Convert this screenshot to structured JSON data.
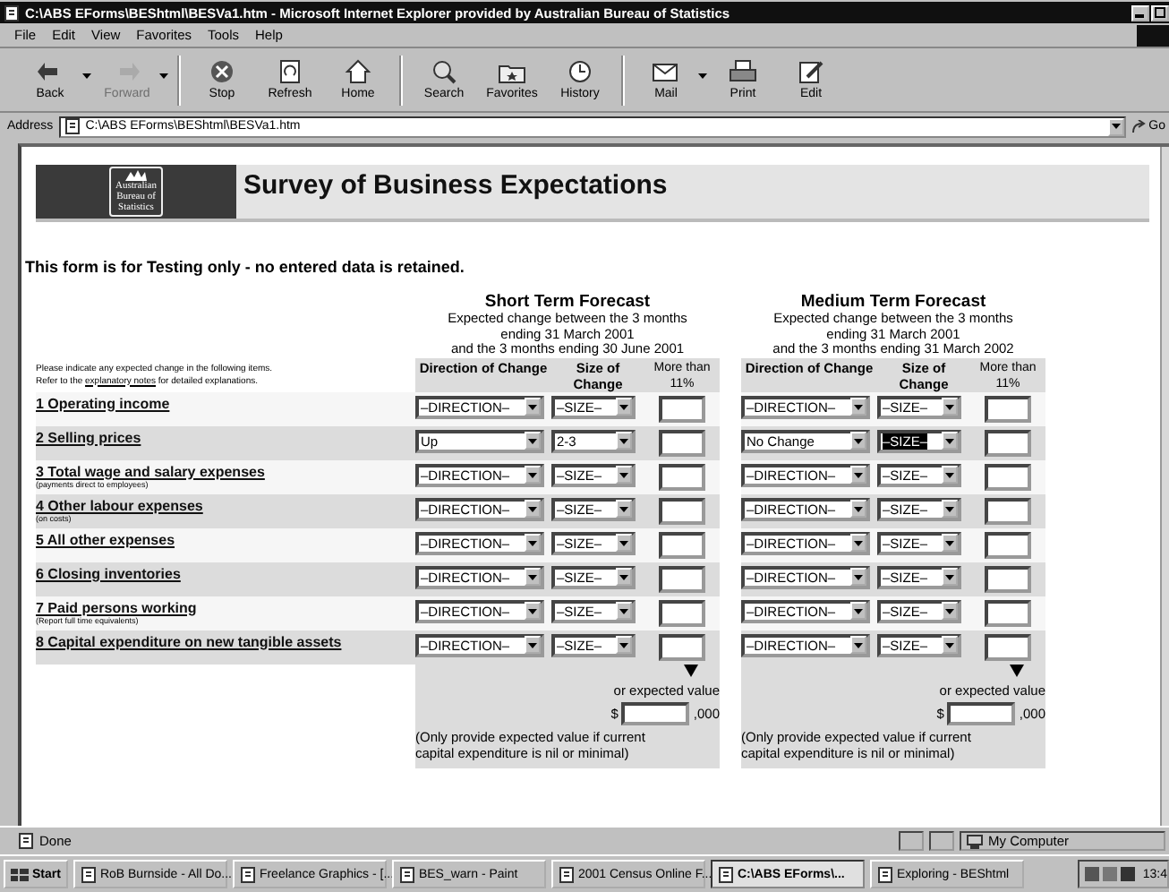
{
  "window": {
    "title": "C:\\ABS EForms\\BEShtml\\BESVa1.htm - Microsoft Internet Explorer provided by Australian Bureau of Statistics"
  },
  "menu": [
    "File",
    "Edit",
    "View",
    "Favorites",
    "Tools",
    "Help"
  ],
  "toolbar": [
    {
      "label": "Back",
      "kind": "back",
      "disabled": false,
      "caret": true
    },
    {
      "label": "Forward",
      "kind": "forward",
      "disabled": true,
      "caret": true
    },
    {
      "label": "Stop",
      "kind": "stop",
      "disabled": false,
      "caret": false
    },
    {
      "label": "Refresh",
      "kind": "refresh",
      "disabled": false,
      "caret": false
    },
    {
      "label": "Home",
      "kind": "home",
      "disabled": false,
      "caret": false
    },
    {
      "label": "Search",
      "kind": "search",
      "disabled": false,
      "caret": false
    },
    {
      "label": "Favorites",
      "kind": "favorites",
      "disabled": false,
      "caret": false
    },
    {
      "label": "History",
      "kind": "history",
      "disabled": false,
      "caret": false
    },
    {
      "label": "Mail",
      "kind": "mail",
      "disabled": false,
      "caret": true
    },
    {
      "label": "Print",
      "kind": "print",
      "disabled": false,
      "caret": false
    },
    {
      "label": "Edit",
      "kind": "edit",
      "disabled": false,
      "caret": false
    }
  ],
  "address": {
    "label": "Address",
    "value": "C:\\ABS EForms\\BEShtml\\BESVa1.htm",
    "go": "Go"
  },
  "page": {
    "logo": [
      "Australian",
      "Bureau of",
      "Statistics"
    ],
    "title": "Survey of Business Expectations",
    "notice": "This form is for Testing only - no entered data is retained.",
    "intro": {
      "line": "Please indicate any expected change in the following items.",
      "before": "Refer to the ",
      "link": "explanatory notes",
      "after": " for detailed explanations."
    },
    "forecasts": [
      {
        "title": "Short Term Forecast",
        "description": [
          "Expected change between the 3 months",
          "ending 31 March 2001",
          "and the 3 months ending 30 June 2001"
        ],
        "columns": [
          "Direction of Change",
          "Size of Change",
          "More than 11%"
        ],
        "expected": {
          "label": "or expected value",
          "currency": "$",
          "suffix": ",000",
          "note": "(Only provide expected value if current capital expenditure is nil or minimal)"
        }
      },
      {
        "title": "Medium Term Forecast",
        "description": [
          "Expected change between the 3 months",
          "ending 31 March 2001",
          "and the 3 months ending 31 March 2002"
        ],
        "columns": [
          "Direction of Change",
          "Size of Change",
          "More than 11%"
        ],
        "expected": {
          "label": "or expected value",
          "currency": "$",
          "suffix": ",000",
          "note": "(Only provide expected value if current capital expenditure is nil or minimal)"
        }
      }
    ],
    "rows": [
      {
        "label": "1 Operating income",
        "short": [
          {
            "value": "–DIRECTION–",
            "focused": false
          },
          {
            "value": "–SIZE–",
            "focused": false
          }
        ],
        "medium": [
          {
            "value": "–DIRECTION–",
            "focused": false
          },
          {
            "value": "–SIZE–",
            "focused": false
          }
        ]
      },
      {
        "label": "2 Selling prices",
        "short": [
          {
            "value": "Up",
            "focused": false
          },
          {
            "value": "2-3",
            "focused": false
          }
        ],
        "medium": [
          {
            "value": "No Change",
            "focused": false
          },
          {
            "value": "–SIZE–",
            "focused": true
          }
        ]
      },
      {
        "label": "3 Total wage and salary expenses",
        "note": "(payments direct to employees)",
        "short": [
          {
            "value": "–DIRECTION–",
            "focused": false
          },
          {
            "value": "–SIZE–",
            "focused": false
          }
        ],
        "medium": [
          {
            "value": "–DIRECTION–",
            "focused": false
          },
          {
            "value": "–SIZE–",
            "focused": false
          }
        ]
      },
      {
        "label": "4 Other labour expenses",
        "note": "(on costs)",
        "short": [
          {
            "value": "–DIRECTION–",
            "focused": false
          },
          {
            "value": "–SIZE–",
            "focused": false
          }
        ],
        "medium": [
          {
            "value": "–DIRECTION–",
            "focused": false
          },
          {
            "value": "–SIZE–",
            "focused": false
          }
        ]
      },
      {
        "label": "5 All other expenses",
        "short": [
          {
            "value": "–DIRECTION–",
            "focused": false
          },
          {
            "value": "–SIZE–",
            "focused": false
          }
        ],
        "medium": [
          {
            "value": "–DIRECTION–",
            "focused": false
          },
          {
            "value": "–SIZE–",
            "focused": false
          }
        ]
      },
      {
        "label": "6 Closing inventories",
        "short": [
          {
            "value": "–DIRECTION–",
            "focused": false
          },
          {
            "value": "–SIZE–",
            "focused": false
          }
        ],
        "medium": [
          {
            "value": "–DIRECTION–",
            "focused": false
          },
          {
            "value": "–SIZE–",
            "focused": false
          }
        ]
      },
      {
        "label": "7 Paid persons working",
        "note": "(Report full time equivalents)",
        "short": [
          {
            "value": "–DIRECTION–",
            "focused": false
          },
          {
            "value": "–SIZE–",
            "focused": false
          }
        ],
        "medium": [
          {
            "value": "–DIRECTION–",
            "focused": false
          },
          {
            "value": "–SIZE–",
            "focused": false
          }
        ]
      },
      {
        "label": "8 Capital expenditure on new tangible assets",
        "short": [
          {
            "value": "–DIRECTION–",
            "focused": false
          },
          {
            "value": "–SIZE–",
            "focused": false
          }
        ],
        "medium": [
          {
            "value": "–DIRECTION–",
            "focused": false
          },
          {
            "value": "–SIZE–",
            "focused": false
          }
        ]
      }
    ]
  },
  "status_bar": {
    "text": "Done",
    "zone": "My Computer"
  },
  "taskbar": {
    "start": "Start",
    "items": [
      {
        "label": "RoB Burnside - All Do...",
        "selected": false
      },
      {
        "label": "Freelance Graphics - [...",
        "selected": false
      },
      {
        "label": "BES_warn - Paint",
        "selected": false
      },
      {
        "label": "2001 Census Online F...",
        "selected": false
      },
      {
        "label": "C:\\ABS EForms\\...",
        "selected": true
      },
      {
        "label": "Exploring - BEShtml",
        "selected": false
      }
    ],
    "clock": "13:4"
  }
}
